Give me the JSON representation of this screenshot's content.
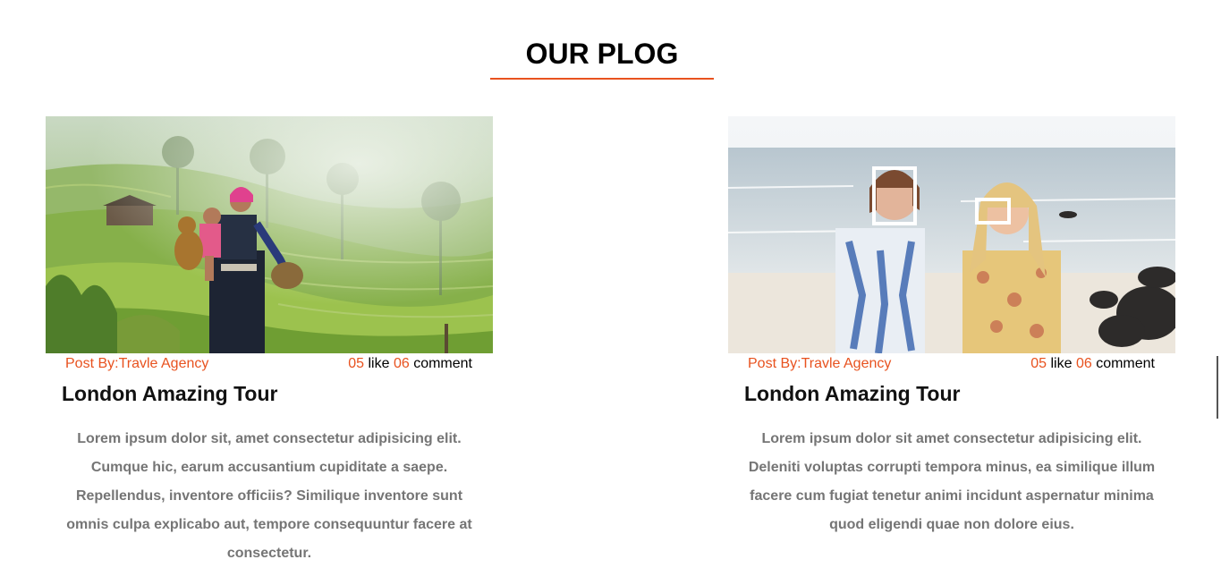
{
  "section": {
    "title": "OUR PLOG",
    "accent_color": "#e8521f"
  },
  "posts": [
    {
      "image_alt": "Woman in traditional clothing carrying a child in green rice terraces",
      "author": "Post By:Travle Agency",
      "likes": "05",
      "like_label": "like",
      "comments": "06",
      "comment_label": "comment",
      "title": "London Amazing Tour",
      "body": "Lorem ipsum dolor sit, amet consectetur adipisicing elit. Cumque hic, earum accusantium cupiditate a saepe. Repellendus, inventore officiis? Similique inventore sunt omnis culpa explicabo aut, tempore consequuntur facere at consectetur."
    },
    {
      "image_alt": "Two women holding photo frames on a beach",
      "author": "Post By:Travle Agency",
      "likes": "05",
      "like_label": "like",
      "comments": "06",
      "comment_label": "comment",
      "title": "London Amazing Tour",
      "body": "Lorem ipsum dolor sit amet consectetur adipisicing elit. Deleniti voluptas corrupti tempora minus, ea similique illum facere cum fugiat tenetur animi incidunt aspernatur minima quod eligendi quae non dolore eius."
    }
  ]
}
